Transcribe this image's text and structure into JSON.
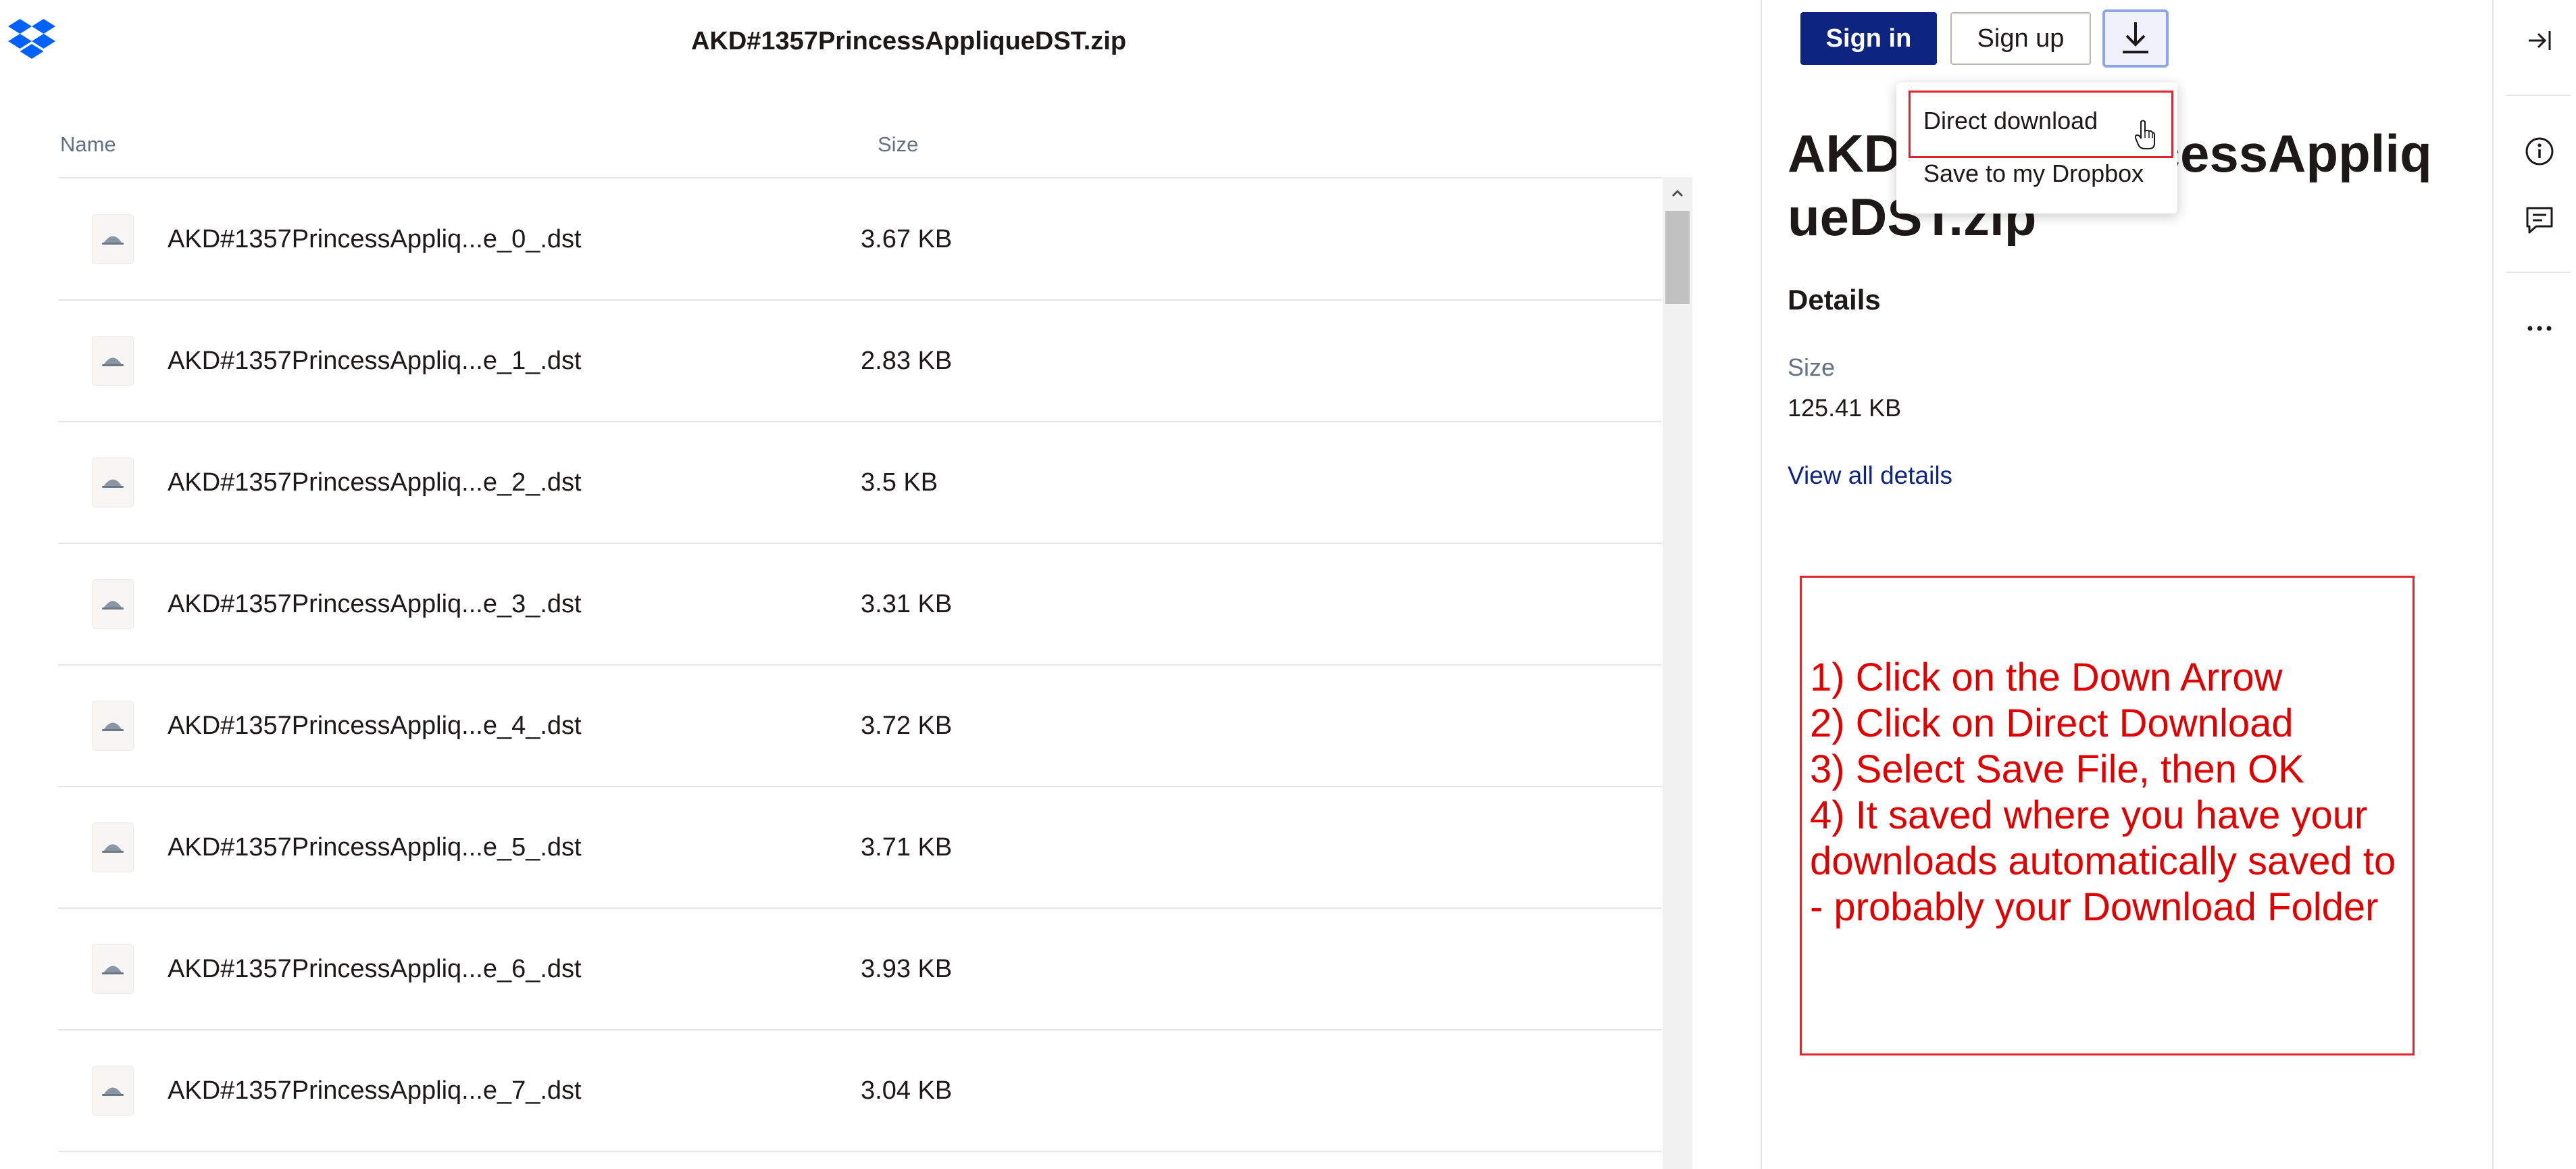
{
  "header": {
    "logo_icon": "dropbox-logo-icon",
    "title": "AKD#1357PrincessAppliqueDST.zip"
  },
  "file_list": {
    "columns": {
      "name": "Name",
      "size": "Size"
    },
    "file_icon": "embroidery-file-icon",
    "rows": [
      {
        "name": "AKD#1357PrincessAppliq...e_0_.dst",
        "size": "3.67 KB"
      },
      {
        "name": "AKD#1357PrincessAppliq...e_1_.dst",
        "size": "2.83 KB"
      },
      {
        "name": "AKD#1357PrincessAppliq...e_2_.dst",
        "size": "3.5 KB"
      },
      {
        "name": "AKD#1357PrincessAppliq...e_3_.dst",
        "size": "3.31 KB"
      },
      {
        "name": "AKD#1357PrincessAppliq...e_4_.dst",
        "size": "3.72 KB"
      },
      {
        "name": "AKD#1357PrincessAppliq...e_5_.dst",
        "size": "3.71 KB"
      },
      {
        "name": "AKD#1357PrincessAppliq...e_6_.dst",
        "size": "3.93 KB"
      },
      {
        "name": "AKD#1357PrincessAppliq...e_7_.dst",
        "size": "3.04 KB"
      }
    ]
  },
  "actions": {
    "sign_in": "Sign in",
    "sign_up": "Sign up",
    "download_icon": "download-arrow-icon"
  },
  "download_menu": {
    "items": [
      "Direct download",
      "Save to my Dropbox"
    ]
  },
  "panel": {
    "title": "AKD#1357PrincessAppliqueDST.zip",
    "details_heading": "Details",
    "size_label": "Size",
    "size_value": "125.41 KB",
    "view_all": "View all details"
  },
  "instructions": {
    "lines": [
      "1) Click on the Down Arrow",
      "2) Click on Direct Download",
      "3) Select Save File, then OK",
      "4) It saved where you have your downloads automatically saved to - probably your Download Folder"
    ]
  },
  "rail": {
    "icons": [
      "collapse-panel-icon",
      "info-icon",
      "comment-icon",
      "more-icon"
    ]
  },
  "colors": {
    "brand_blue": "#0d2481",
    "annotation_red": "#e00000",
    "muted_text": "#637282"
  }
}
